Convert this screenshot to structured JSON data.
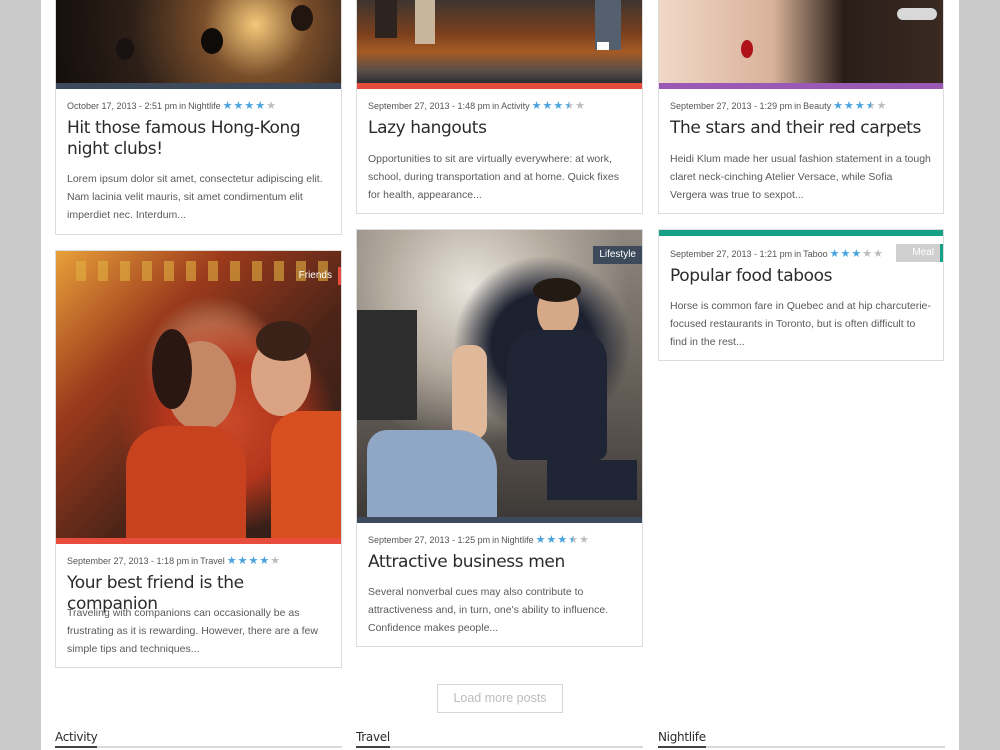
{
  "posts": [
    {
      "meta": "October 17, 2013 - 2:51 pm",
      "in_label": "in",
      "category": "Nightlife",
      "rating": 4,
      "title": "Hit those famous Hong-Kong night clubs!",
      "excerpt": "Lorem ipsum dolor sit amet, consectetur adipiscing elit. Nam lacinia velit mauris, sit amet condimentum elit imperdiet nec. Interdum...",
      "accent": "#3d4a5c"
    },
    {
      "meta": "September 27, 2013 - 1:48 pm",
      "in_label": "in",
      "category": "Activity",
      "rating": 3.5,
      "title": "Lazy hangouts",
      "excerpt": "Opportunities to sit are virtually everywhere: at work, school, during transportation and at home. Quick fixes for health, appearance...",
      "accent": "#e74c3c"
    },
    {
      "meta": "September 27, 2013 - 1:29 pm",
      "in_label": "in",
      "category": "Beauty",
      "rating": 3.5,
      "title": "The stars and their red carpets",
      "excerpt": "Heidi Klum made her usual fashion statement in a tough claret neck-cinching Atelier Versace, while Sofia Vergera was true to sexpot...",
      "accent": "#9b59b6"
    },
    {
      "meta": "September 27, 2013 - 1:18 pm",
      "in_label": "in",
      "category": "Travel",
      "rating": 4,
      "title": "Your best friend is the companion",
      "excerpt": "Traveling with companions can occasionally be as frustrating as it is rewarding. However, there are a few simple tips and techniques...",
      "accent": "#e74c3c",
      "tag": "Friends"
    },
    {
      "meta": "September 27, 2013 - 1:25 pm",
      "in_label": "in",
      "category": "Nightlife",
      "rating": 3.5,
      "title": "Attractive business men",
      "excerpt": "Several nonverbal cues may also contribute to attractiveness and, in turn, one's ability to influence. Confidence makes people...",
      "accent": "#3d4a5c",
      "tag": "Lifestyle"
    },
    {
      "meta": "September 27, 2013 - 1:21 pm",
      "in_label": "in",
      "category": "Taboo",
      "rating": 3,
      "title": "Popular food taboos",
      "excerpt": "Horse is common fare in Quebec and at hip charcuterie-focused restaurants in Toronto, but is often difficult to find in the rest...",
      "accent": "#16a085",
      "tag": "Meal"
    }
  ],
  "load_more": "Load more posts",
  "footer": [
    "Activity",
    "Travel",
    "Nightlife"
  ],
  "colors": {
    "star_on": "#4aa3df",
    "star_off": "#bdbdbd",
    "tag_friends": "#e74c3c",
    "tag_lifestyle": "#3d4a5c",
    "tag_meal": "#cfcfcf"
  }
}
